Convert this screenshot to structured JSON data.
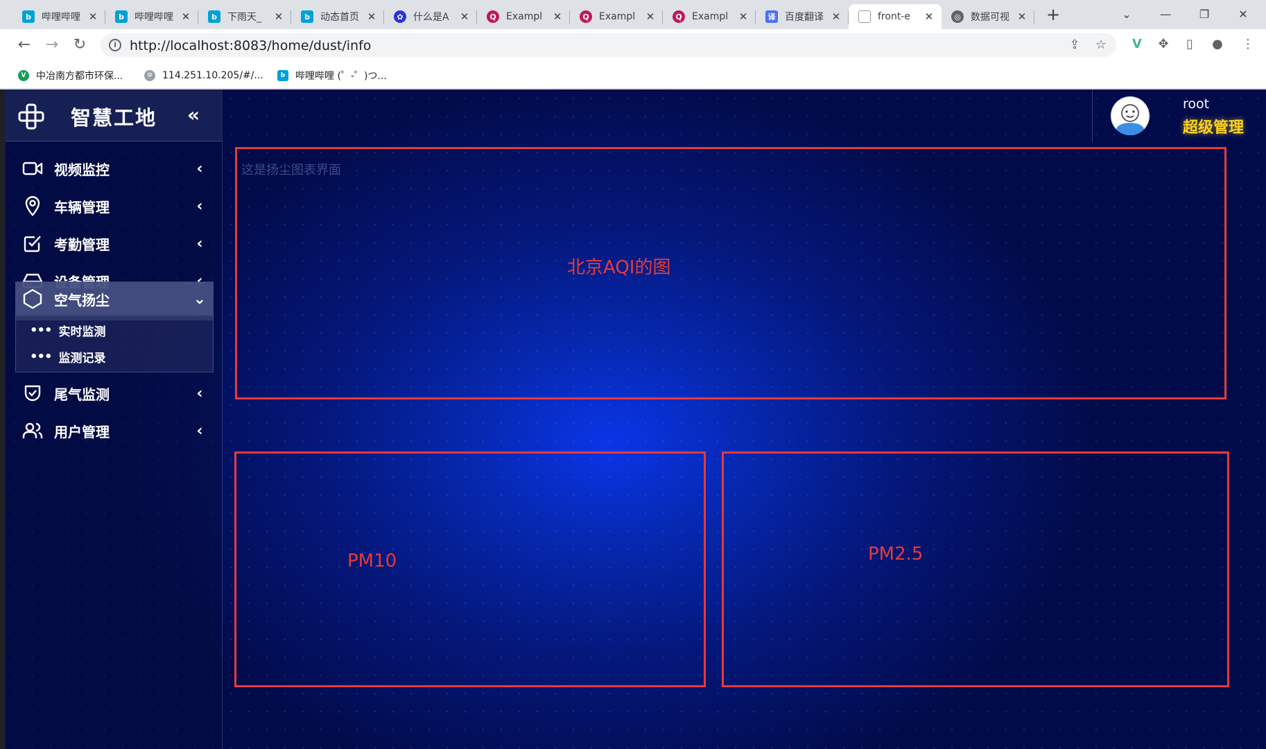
{
  "browser": {
    "tabs": [
      {
        "title": "哔哩哔哩",
        "favicon": "bilibili-icon",
        "active": false
      },
      {
        "title": "哔哩哔哩",
        "favicon": "bilibili-icon",
        "active": false
      },
      {
        "title": "下雨天_",
        "favicon": "bilibili-icon",
        "active": false
      },
      {
        "title": "动态首页",
        "favicon": "bilibili-icon",
        "active": false
      },
      {
        "title": "什么是A",
        "favicon": "baidu-paw-icon",
        "active": false
      },
      {
        "title": "Exampl",
        "favicon": "example-icon",
        "active": false
      },
      {
        "title": "Exampl",
        "favicon": "example-icon",
        "active": false
      },
      {
        "title": "Exampl",
        "favicon": "example-icon",
        "active": false
      },
      {
        "title": "百度翻译",
        "favicon": "fanyi-icon",
        "active": false
      },
      {
        "title": "front-e",
        "favicon": "document-icon",
        "active": true
      },
      {
        "title": "数据可视",
        "favicon": "globe-icon",
        "active": false
      }
    ],
    "tab_close_glyph": "✕",
    "new_tab_glyph": "+",
    "url": "http://localhost:8083/home/dust/info",
    "bookmarks": [
      {
        "label": "中冶南方都市环保...",
        "icon": "vue-icon"
      },
      {
        "label": "114.251.10.205/#/...",
        "icon": "gear-icon"
      },
      {
        "label": "哔哩哔哩 (゜-゜)つ...",
        "icon": "bilibili-icon"
      }
    ]
  },
  "sidebar": {
    "title": "智慧工地",
    "collapse_glyph": "«",
    "items": [
      {
        "label": "视频监控",
        "icon": "video-camera-icon",
        "expanded": false
      },
      {
        "label": "车辆管理",
        "icon": "map-pin-icon",
        "expanded": false
      },
      {
        "label": "考勤管理",
        "icon": "check-square-icon",
        "expanded": false
      },
      {
        "label": "设备管理",
        "icon": "device-drive-icon",
        "expanded": false
      },
      {
        "label": "空气扬尘",
        "icon": "hexagon-icon",
        "expanded": true
      },
      {
        "label": "尾气监测",
        "icon": "shield-check-icon",
        "expanded": false
      },
      {
        "label": "用户管理",
        "icon": "users-icon",
        "expanded": false
      }
    ],
    "submenu": [
      {
        "label": "实时监测"
      },
      {
        "label": "监测记录"
      }
    ]
  },
  "user": {
    "name": "root",
    "role": "超级管理"
  },
  "main": {
    "hint": "这是扬尘图表界面",
    "panels": {
      "aqi": "北京AQI的图",
      "pm10": "PM10",
      "pm25": "PM2.5"
    }
  },
  "colors": {
    "panel_border": "#e63a3a",
    "role_text": "#ffd21f",
    "background_center": "#0a35e8",
    "background_edge": "#020b4a"
  }
}
